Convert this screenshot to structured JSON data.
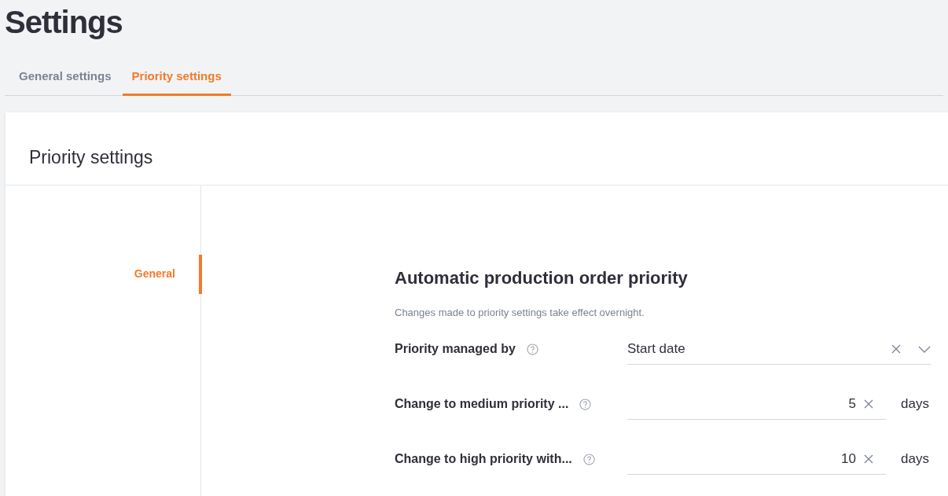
{
  "page_title": "Settings",
  "tabs": [
    {
      "label": "General settings",
      "selected": false
    },
    {
      "label": "Priority settings",
      "selected": true
    }
  ],
  "card": {
    "title": "Priority settings",
    "nav": [
      {
        "label": "General",
        "selected": true
      }
    ],
    "section": {
      "title": "Automatic production order priority",
      "description": "Changes made to priority settings take effect overnight.",
      "fields": [
        {
          "kind": "select",
          "label": "Priority managed by",
          "value": "Start date"
        },
        {
          "kind": "number",
          "label": "Change to medium priority ...",
          "value": "5",
          "unit": "days"
        },
        {
          "kind": "number",
          "label": "Change to high priority with...",
          "value": "10",
          "unit": "days"
        }
      ]
    }
  }
}
